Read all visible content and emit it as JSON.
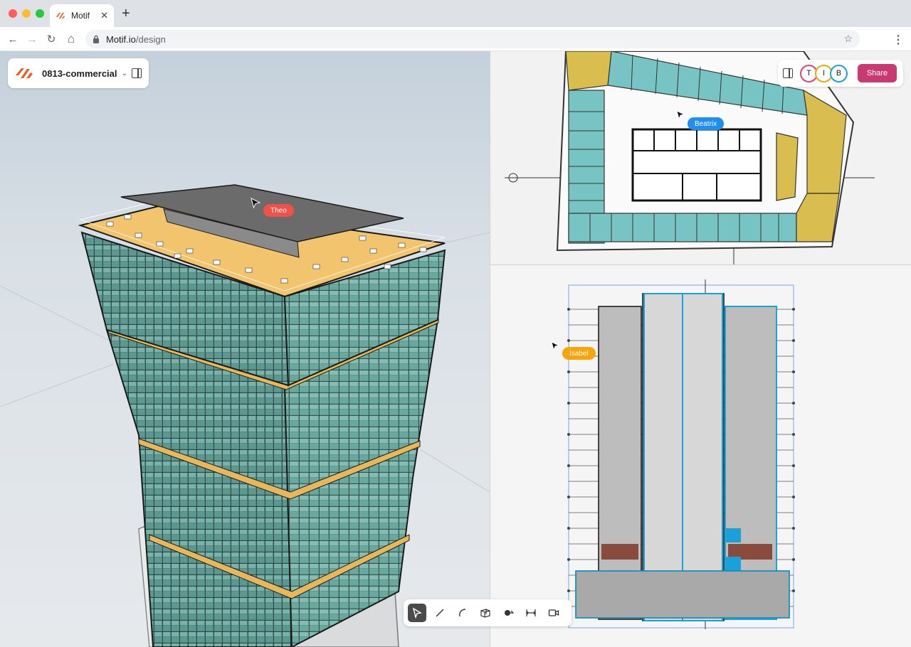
{
  "browser": {
    "tab_title": "Motif",
    "tab_close": "✕",
    "new_tab": "+",
    "url_host": "Motif.io",
    "url_path": "/design",
    "back": "←",
    "forward": "→",
    "reload": "↻",
    "home": "⌂",
    "bookmark": "☆",
    "menu": "⋮"
  },
  "project": {
    "name": "0813-commercial",
    "chevron": "⌄"
  },
  "collaborators": {
    "avatars": [
      "T",
      "I",
      "B"
    ],
    "share_label": "Share"
  },
  "cursors": [
    {
      "name": "Theo",
      "color": "#f0514b"
    },
    {
      "name": "Beatrix",
      "color": "#1e8ef0"
    },
    {
      "name": "Isabel",
      "color": "#f6a60a"
    }
  ],
  "tools": [
    "select-tool",
    "line-tool",
    "arc-tool",
    "box-tool",
    "shape-tool",
    "dimension-tool",
    "camera-tool"
  ],
  "colors": {
    "accent": "#c93a72",
    "brand": "#f05a28"
  }
}
